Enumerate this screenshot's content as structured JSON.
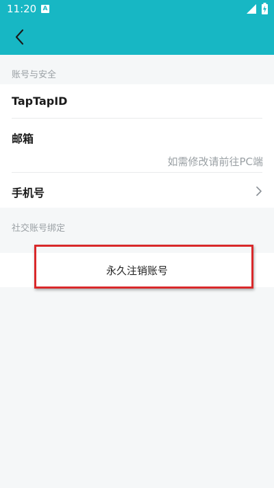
{
  "status_bar": {
    "time": "11:20",
    "notification_badge": "A",
    "icons": [
      "signal-icon",
      "battery-charging-icon"
    ]
  },
  "header": {
    "back_icon": "chevron-left-icon",
    "background_color": "#17b7c4"
  },
  "sections": {
    "account_security": "账号与安全",
    "social_binding": "社交账号绑定"
  },
  "rows": {
    "taptap_id": "TapTapID",
    "email": {
      "label": "邮箱",
      "hint": "如需修改请前往PC端"
    },
    "phone": {
      "label": "手机号",
      "chevron_icon": "chevron-right-icon"
    }
  },
  "actions": {
    "delete_account": "永久注销账号"
  },
  "annotation_color": "#d9282a"
}
